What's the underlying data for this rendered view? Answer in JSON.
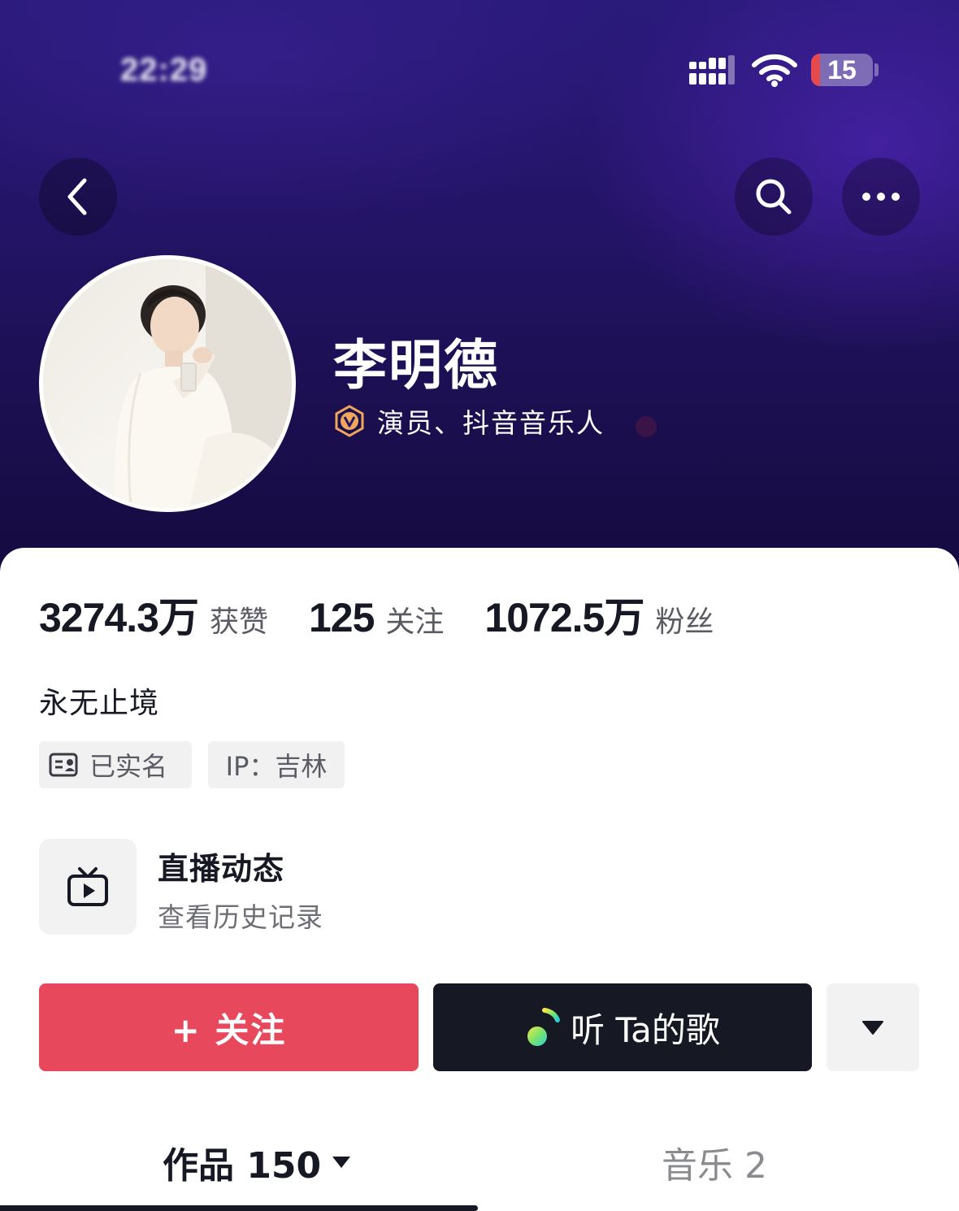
{
  "status_bar": {
    "time": "22:29",
    "battery": "15",
    "battery_level_percent": 15,
    "icons": [
      "signal-icon",
      "wifi-icon",
      "battery-icon"
    ]
  },
  "nav": {
    "icons": [
      "back-arrow-icon",
      "search-icon",
      "more-dots-icon"
    ]
  },
  "profile": {
    "name": "李明德",
    "verification": "演员、抖音音乐人",
    "verify_icon": "verified-v-badge-icon",
    "verify_color": "#f0a75a"
  },
  "stats": [
    {
      "value": "3274.3万",
      "label": "获赞"
    },
    {
      "value": "125",
      "label": "关注"
    },
    {
      "value": "1072.5万",
      "label": "粉丝"
    }
  ],
  "bio": "永无止境",
  "tags": {
    "verified": "已实名",
    "ip": "IP：吉林"
  },
  "live": {
    "title": "直播动态",
    "subtitle": "查看历史记录"
  },
  "actions": {
    "follow": "+ 关注",
    "listen": "听 Ta的歌",
    "follow_color": "#e8485c",
    "listen_color": "#161823"
  },
  "tabs": [
    {
      "label": "作品 150",
      "active": true
    },
    {
      "label": "音乐 2",
      "active": false
    }
  ]
}
